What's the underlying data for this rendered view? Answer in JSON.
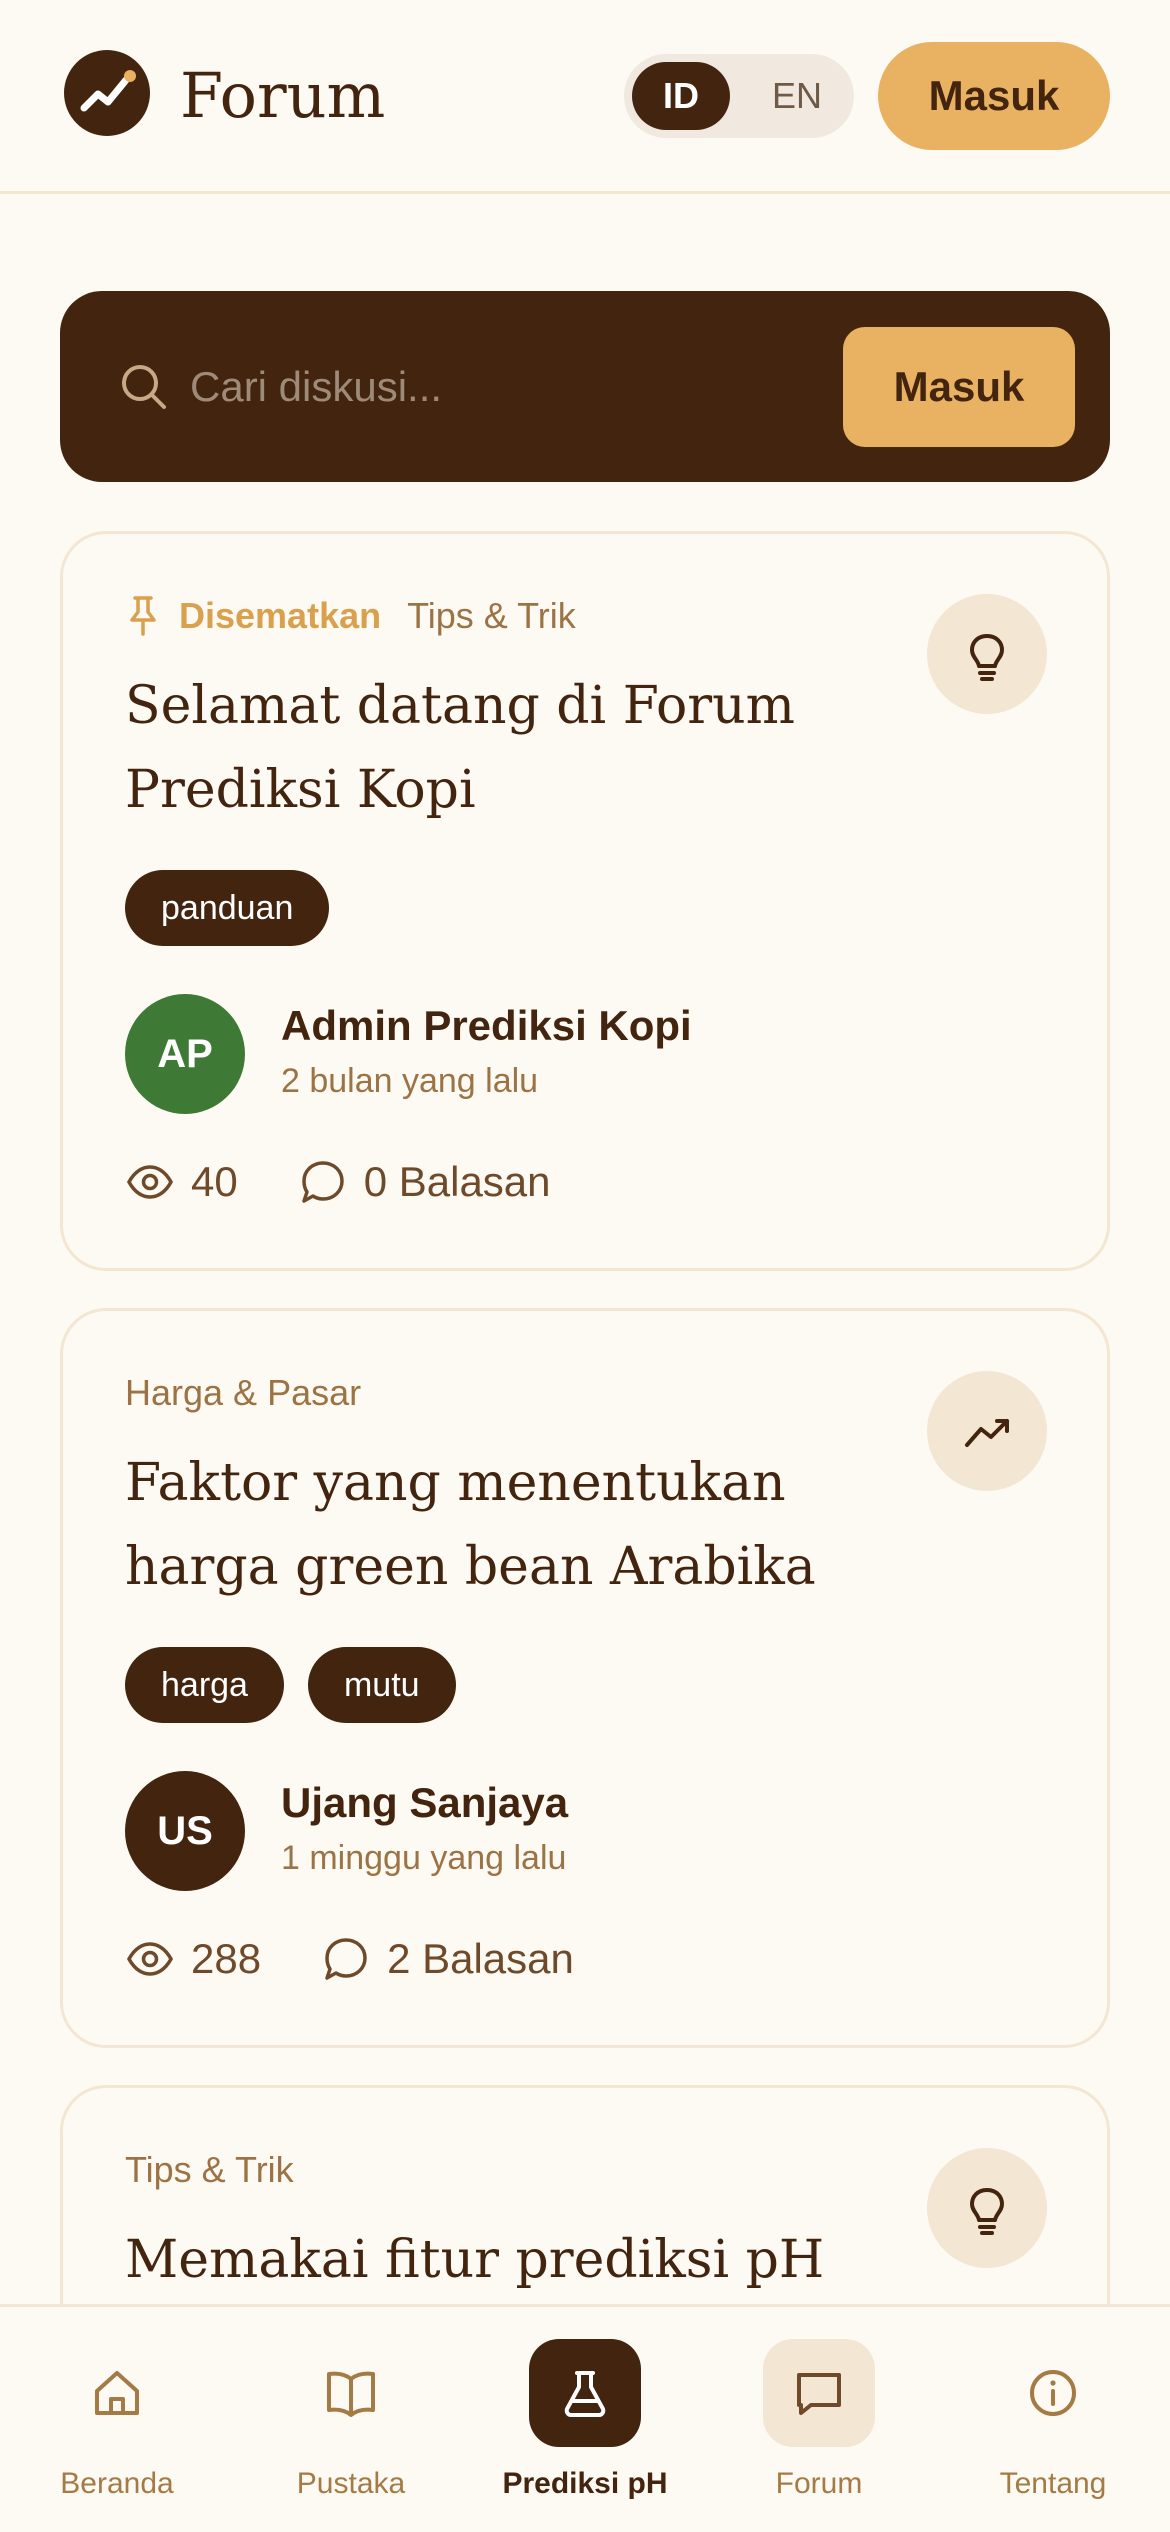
{
  "header": {
    "brand": "Forum",
    "lang_options": [
      "ID",
      "EN"
    ],
    "lang_selected": "ID",
    "login_label": "Masuk"
  },
  "search": {
    "placeholder": "Cari diskusi...",
    "button_label": "Masuk"
  },
  "threads": [
    {
      "pinned_label": "Disematkan",
      "category": "Tips & Trik",
      "icon": "lightbulb-icon",
      "title": "Selamat datang di Forum Prediksi Kopi",
      "tags": [
        "panduan"
      ],
      "author": {
        "initials": "AP",
        "name": "Admin Prediksi Kopi",
        "time": "2 bulan yang lalu",
        "color": "#3E7A36"
      },
      "views": "40",
      "replies": "0 Balasan"
    },
    {
      "category": "Harga & Pasar",
      "icon": "trending-up-icon",
      "title": "Faktor yang menentukan harga green bean Arabika",
      "tags": [
        "harga",
        "mutu"
      ],
      "author": {
        "initials": "US",
        "name": "Ujang Sanjaya",
        "time": "1 minggu yang lalu",
        "color": "#43240F"
      },
      "views": "288",
      "replies": "2 Balasan"
    },
    {
      "category": "Tips & Trik",
      "icon": "lightbulb-icon",
      "title": "Memakai fitur prediksi pH"
    }
  ],
  "nav": {
    "items": [
      {
        "label": "Beranda",
        "icon": "home-icon"
      },
      {
        "label": "Pustaka",
        "icon": "book-icon"
      },
      {
        "label": "Prediksi pH",
        "icon": "flask-icon"
      },
      {
        "label": "Forum",
        "icon": "chat-icon"
      },
      {
        "label": "Tentang",
        "icon": "info-icon"
      }
    ],
    "active": "Prediksi pH",
    "current": "Forum"
  },
  "colors": {
    "background": "#FDFAF3",
    "primary_dark": "#43240F",
    "accent": "#E8B262",
    "soft": "#F3E6D2"
  }
}
